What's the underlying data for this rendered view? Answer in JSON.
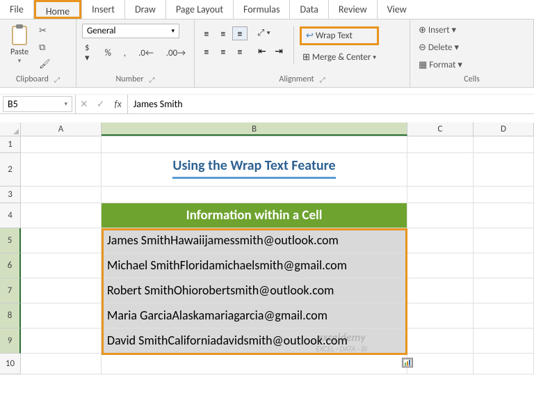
{
  "tabs": {
    "items": [
      "File",
      "Home",
      "Insert",
      "Draw",
      "Page Layout",
      "Formulas",
      "Data",
      "Review",
      "View"
    ],
    "active": "Home"
  },
  "ribbon": {
    "clipboard": {
      "label": "Clipboard",
      "paste": "Paste"
    },
    "number": {
      "label": "Number",
      "format": "General"
    },
    "alignment": {
      "label": "Alignment",
      "wrap": "Wrap Text",
      "merge": "Merge & Center"
    },
    "cells": {
      "label": "Cells",
      "insert": "Insert",
      "delete": "Delete",
      "format": "Format"
    }
  },
  "formula": {
    "name": "B5",
    "value": "James Smith"
  },
  "columns": [
    "A",
    "B",
    "C",
    "D"
  ],
  "sheet": {
    "title": "Using the Wrap Text Feature",
    "header": "Information within a Cell",
    "data": [
      "James SmithHawaiijamessmith@outlook.com",
      "Michael SmithFloridamichaelsmith@gmail.com",
      "Robert SmithOhiorobertsmith@outlook.com",
      "Maria GarciaAlaskamariagarcia@gmail.com",
      "David SmithCaliforniadavidsmith@outlook.com"
    ]
  },
  "watermark": {
    "name": "exceldemy",
    "tag": "EXCEL · DATA · BI"
  }
}
